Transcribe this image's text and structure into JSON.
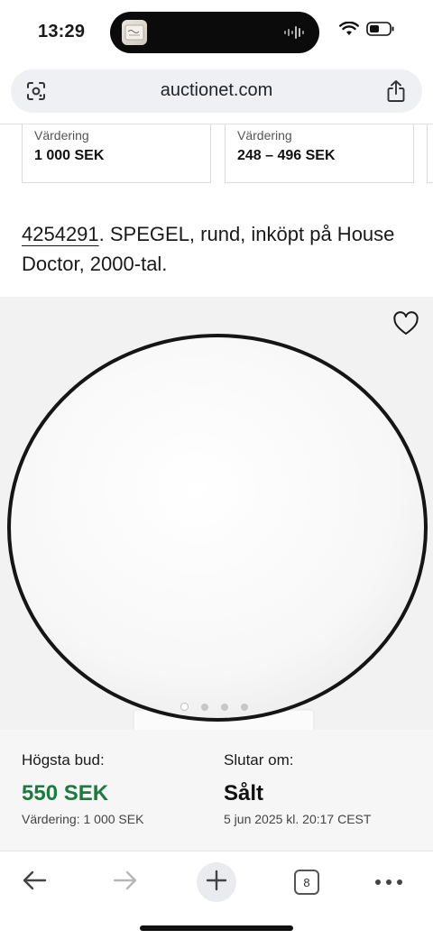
{
  "status_bar": {
    "time": "13:29",
    "icons": [
      "wifi-icon",
      "battery-icon"
    ]
  },
  "browser": {
    "url": "auctionet.com",
    "left_icon": "lens-icon",
    "right_icon": "share-icon"
  },
  "valuation_cards": [
    {
      "label": "Värdering",
      "value": "1 000 SEK"
    },
    {
      "label": "Värdering",
      "value": "248 – 496 SEK"
    }
  ],
  "lot": {
    "number": "4254291",
    "title_rest": ". SPEGEL, rund, inköpt på House Doctor, 2000-tal."
  },
  "gallery": {
    "image_count": 4,
    "active_index": 0,
    "favorite_icon": "heart-icon"
  },
  "bid": {
    "highest_label": "Högsta bud:",
    "highest_amount": "550 SEK",
    "valuation_text": "Värdering: 1 000 SEK",
    "ends_label": "Slutar om:",
    "status": "Sålt",
    "end_time": "5 jun 2025 kl. 20:17 CEST"
  },
  "toolbar": {
    "back_icon": "back-arrow-icon",
    "forward_icon": "forward-arrow-icon",
    "new_tab_icon": "plus-icon",
    "tab_count": "8",
    "menu_icon": "more-icon"
  },
  "colors": {
    "accent_green": "#1d7a3e",
    "address_bar_bg": "#eef0f3"
  }
}
